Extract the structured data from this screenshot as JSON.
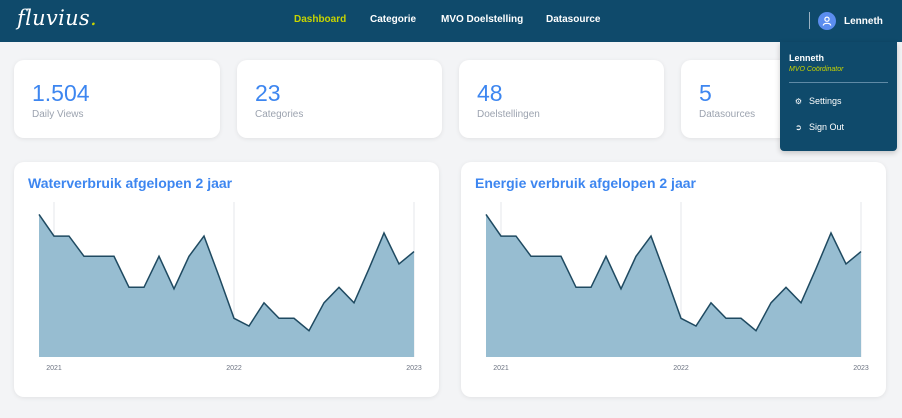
{
  "navbar": {
    "logo_text": "fluvius",
    "logo_dot": ".",
    "links": [
      "Dashboard",
      "Categorie",
      "MVO Doelstelling",
      "Datasource"
    ],
    "active_link": "Dashboard",
    "user_name": "Lenneth"
  },
  "user_menu": {
    "name": "Lenneth",
    "role": "MVO Coördinator",
    "items": [
      "Settings",
      "Sign Out"
    ]
  },
  "stats": [
    {
      "value": "1.504",
      "label": "Daily Views"
    },
    {
      "value": "23",
      "label": "Categories"
    },
    {
      "value": "48",
      "label": "Doelstellingen"
    },
    {
      "value": "5",
      "label": "Datasources"
    }
  ],
  "colors": {
    "navbar": "#0f4a6b",
    "accent": "#3d86f0",
    "active_link": "#c8d400",
    "area_fill": "#97bdd1",
    "area_line": "#1f4a61"
  },
  "chart_data": [
    {
      "type": "area",
      "title": "Waterverbruik afgelopen 2 jaar",
      "xlabel": "",
      "ylabel": "",
      "x_ticks": [
        "2021",
        "2022",
        "2023"
      ],
      "ylim": [
        0,
        100
      ],
      "values": [
        92,
        78,
        78,
        65,
        65,
        65,
        45,
        45,
        65,
        44,
        65,
        78,
        52,
        25,
        20,
        35,
        25,
        25,
        17,
        35,
        45,
        35,
        57,
        80,
        60,
        68
      ],
      "grid": "vertical lines at ticks"
    },
    {
      "type": "area",
      "title": "Energie verbruik afgelopen 2 jaar",
      "xlabel": "",
      "ylabel": "",
      "x_ticks": [
        "2021",
        "2022",
        "2023"
      ],
      "ylim": [
        0,
        100
      ],
      "values": [
        92,
        78,
        78,
        65,
        65,
        65,
        45,
        45,
        65,
        44,
        65,
        78,
        52,
        25,
        20,
        35,
        25,
        25,
        17,
        35,
        45,
        35,
        57,
        80,
        60,
        68
      ],
      "grid": "vertical lines at ticks"
    }
  ]
}
